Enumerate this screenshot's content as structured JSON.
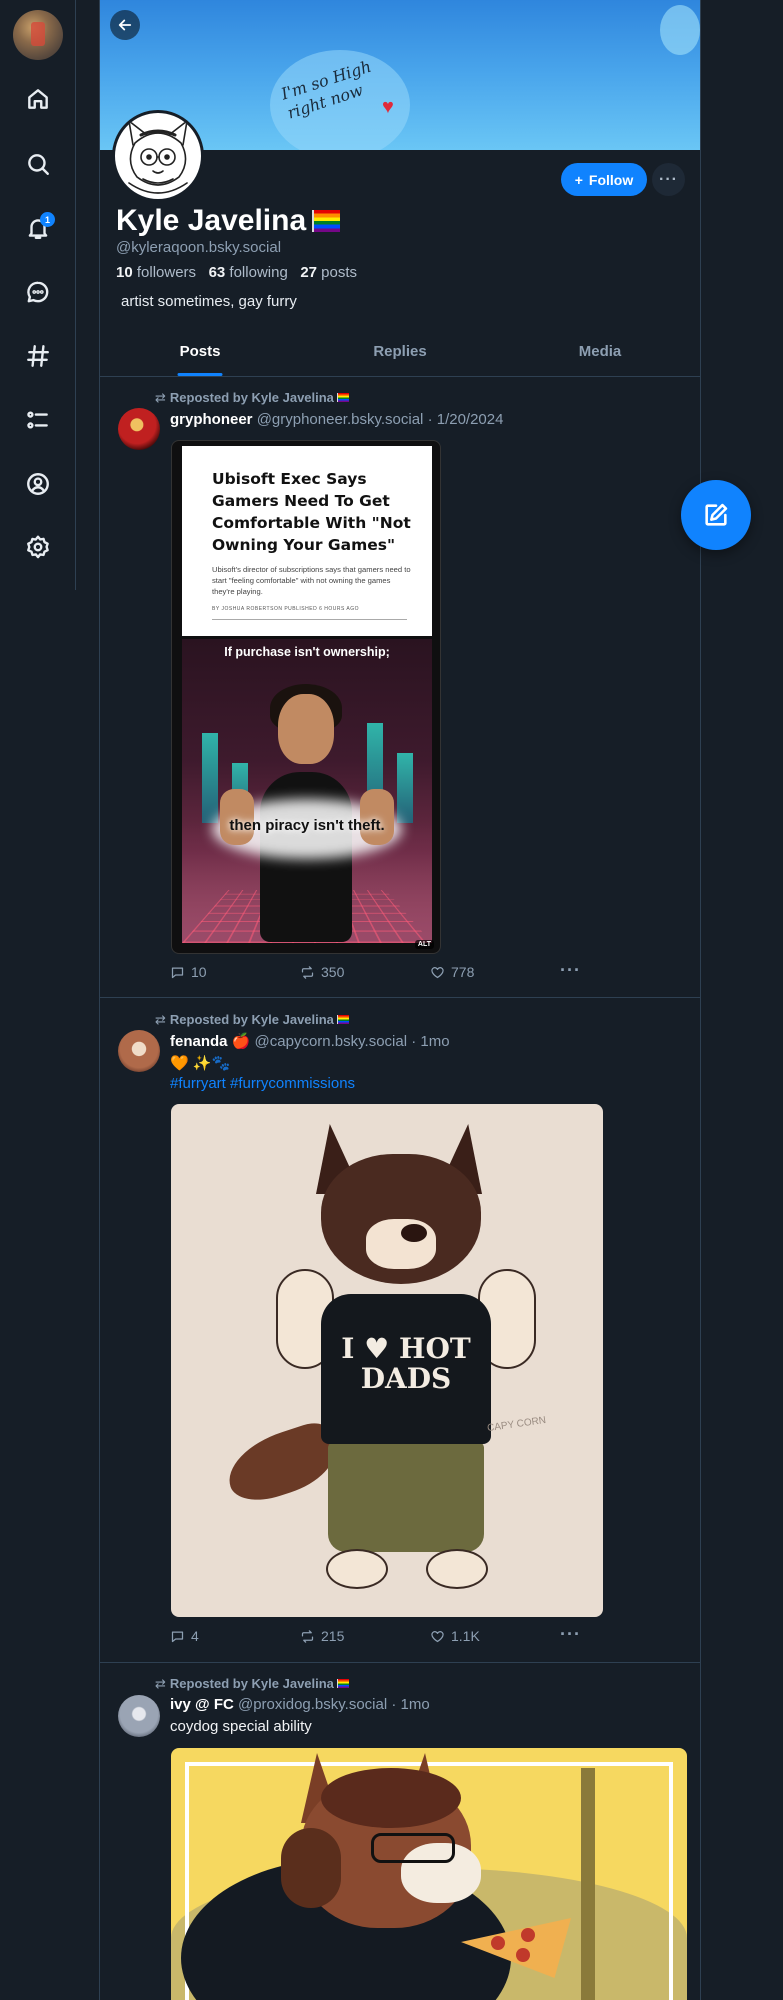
{
  "nav": {
    "notifications_badge": "1",
    "items": [
      "home-icon",
      "search-icon",
      "bell-icon",
      "chat-icon",
      "hashtag-icon",
      "list-icon",
      "profile-icon",
      "gear-icon"
    ]
  },
  "profile": {
    "display_name": "Kyle Javelina",
    "handle": "@kyleraqoon.bsky.social",
    "followers_count": "10",
    "followers_label": "followers",
    "following_count": "63",
    "following_label": "following",
    "posts_count": "27",
    "posts_label": "posts",
    "bio": "artist sometimes, gay furry",
    "follow_label": "Follow",
    "banner_text": "I'm so High right now"
  },
  "tabs": [
    {
      "label": "Posts",
      "active": true
    },
    {
      "label": "Replies",
      "active": false
    },
    {
      "label": "Media",
      "active": false
    }
  ],
  "posts": [
    {
      "repost_label": "Reposted by Kyle Javelina",
      "author": "gryphoneer",
      "handle": "@gryphoneer.bsky.social",
      "time": "· 1/20/2024",
      "image": {
        "headline": "Ubisoft Exec Says Gamers Need To Get Comfortable With \"Not Owning Your Games\"",
        "sub": "Ubisoft's director of subscriptions says that gamers need to start \"feeling comfortable\" with not owning the games they're playing.",
        "byline": "BY JOSHUA ROBERTSON     PUBLISHED 6 HOURS AGO",
        "caption_top": "If purchase isn't ownership;",
        "caption_bottom": "then piracy isn't theft.",
        "alt_badge": "ALT"
      },
      "replies": "10",
      "reposts": "350",
      "likes": "778"
    },
    {
      "repost_label": "Reposted by Kyle Javelina",
      "author": "fenanda",
      "author_emoji": "🍎",
      "handle": "@capycorn.bsky.social",
      "time": "· 1mo",
      "text": "🧡 ✨🐾",
      "tags": "#furryart #furrycommissions",
      "image": {
        "shirt_line1": "I ♥ HOT",
        "shirt_line2": "DADS",
        "signature": "CAPY CORN"
      },
      "replies": "4",
      "reposts": "215",
      "likes": "1.1K"
    },
    {
      "repost_label": "Reposted by Kyle Javelina",
      "author": "ivy @ FC",
      "handle": "@proxidog.bsky.social",
      "time": "· 1mo",
      "text": "coydog special ability"
    }
  ],
  "colors": {
    "background": "#161e27",
    "accent": "#1083fe",
    "border": "#2e4052",
    "muted_text": "#8d9fb2"
  }
}
